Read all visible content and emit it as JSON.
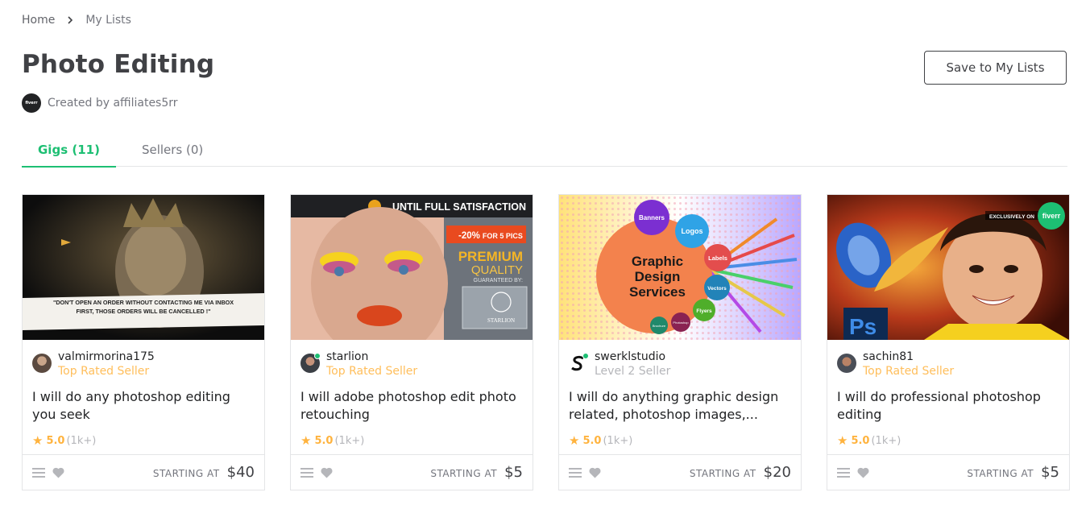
{
  "breadcrumb": {
    "home": "Home",
    "current": "My Lists"
  },
  "page": {
    "title": "Photo Editing",
    "creator_text": "Created by affiliates5rr",
    "creator_avatar_text": "fiverr"
  },
  "actions": {
    "save_label": "Save to My Lists"
  },
  "tabs": [
    {
      "label": "Gigs (11)",
      "active": true
    },
    {
      "label": "Sellers (0)",
      "active": false
    }
  ],
  "gigs": [
    {
      "seller": "valmirmorina175",
      "level": "Top Rated Seller",
      "title": "I will do any photoshop editing you seek",
      "rating": "5.0",
      "reviews": "(1k+)",
      "starting": "STARTING AT",
      "price": "$40",
      "banner_text": "\"DON'T OPEN AN ORDER WITHOUT CONTACTING ME VIA INBOX FIRST, THOSE ORDERS WILL BE CANCELLED !\"",
      "banner_line1": "\"DON'T OPEN AN ORDER WITHOUT CONTACTING ME VIA INBOX",
      "banner_line2": "FIRST, THOSE ORDERS WILL BE CANCELLED !\""
    },
    {
      "seller": "starlion",
      "level": "Top Rated Seller",
      "title": "I will adobe photoshop edit photo retouching",
      "rating": "5.0",
      "reviews": "(1k+)",
      "starting": "STARTING AT",
      "price": "$5",
      "banner_top": "UNTIL FULL SATISFACTION",
      "discount_pct": "-20%",
      "discount_rest": "FOR 5 PICS",
      "premium": "PREMIUM",
      "quality": "QUALITY",
      "guaranteed": "GUARANTEED BY:",
      "brand": "STARLION"
    },
    {
      "seller": "swerklstudio",
      "level": "Level 2 Seller",
      "title": "I will do anything graphic design related, photoshop images,...",
      "rating": "5.0",
      "reviews": "(1k+)",
      "starting": "STARTING AT",
      "price": "$20",
      "service_line1": "Graphic",
      "service_line2": "Design",
      "service_line3": "Services",
      "bubbles": [
        "Banners",
        "Logos",
        "Labels",
        "Vectors",
        "Flyers",
        "Brochure",
        "Photoshop"
      ]
    },
    {
      "seller": "sachin81",
      "level": "Top Rated Seller",
      "title": "I will do professional photoshop editing",
      "rating": "5.0",
      "reviews": "(1k+)",
      "starting": "STARTING AT",
      "price": "$5",
      "exclusive": "EXCLUSIVELY ON",
      "brand": "fiverr"
    }
  ],
  "colors": {
    "accent": "#1dbf73",
    "star": "#ffb33e",
    "top_rated": "#ffbe5b"
  }
}
